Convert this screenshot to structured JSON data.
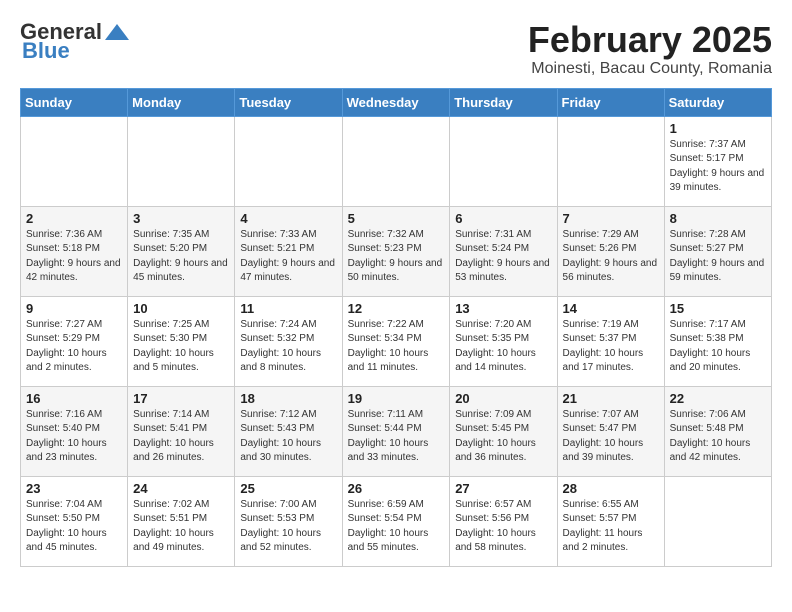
{
  "logo": {
    "general": "General",
    "blue": "Blue"
  },
  "title": "February 2025",
  "subtitle": "Moinesti, Bacau County, Romania",
  "days_of_week": [
    "Sunday",
    "Monday",
    "Tuesday",
    "Wednesday",
    "Thursday",
    "Friday",
    "Saturday"
  ],
  "weeks": [
    [
      {
        "day": "",
        "info": ""
      },
      {
        "day": "",
        "info": ""
      },
      {
        "day": "",
        "info": ""
      },
      {
        "day": "",
        "info": ""
      },
      {
        "day": "",
        "info": ""
      },
      {
        "day": "",
        "info": ""
      },
      {
        "day": "1",
        "info": "Sunrise: 7:37 AM\nSunset: 5:17 PM\nDaylight: 9 hours and 39 minutes."
      }
    ],
    [
      {
        "day": "2",
        "info": "Sunrise: 7:36 AM\nSunset: 5:18 PM\nDaylight: 9 hours and 42 minutes."
      },
      {
        "day": "3",
        "info": "Sunrise: 7:35 AM\nSunset: 5:20 PM\nDaylight: 9 hours and 45 minutes."
      },
      {
        "day": "4",
        "info": "Sunrise: 7:33 AM\nSunset: 5:21 PM\nDaylight: 9 hours and 47 minutes."
      },
      {
        "day": "5",
        "info": "Sunrise: 7:32 AM\nSunset: 5:23 PM\nDaylight: 9 hours and 50 minutes."
      },
      {
        "day": "6",
        "info": "Sunrise: 7:31 AM\nSunset: 5:24 PM\nDaylight: 9 hours and 53 minutes."
      },
      {
        "day": "7",
        "info": "Sunrise: 7:29 AM\nSunset: 5:26 PM\nDaylight: 9 hours and 56 minutes."
      },
      {
        "day": "8",
        "info": "Sunrise: 7:28 AM\nSunset: 5:27 PM\nDaylight: 9 hours and 59 minutes."
      }
    ],
    [
      {
        "day": "9",
        "info": "Sunrise: 7:27 AM\nSunset: 5:29 PM\nDaylight: 10 hours and 2 minutes."
      },
      {
        "day": "10",
        "info": "Sunrise: 7:25 AM\nSunset: 5:30 PM\nDaylight: 10 hours and 5 minutes."
      },
      {
        "day": "11",
        "info": "Sunrise: 7:24 AM\nSunset: 5:32 PM\nDaylight: 10 hours and 8 minutes."
      },
      {
        "day": "12",
        "info": "Sunrise: 7:22 AM\nSunset: 5:34 PM\nDaylight: 10 hours and 11 minutes."
      },
      {
        "day": "13",
        "info": "Sunrise: 7:20 AM\nSunset: 5:35 PM\nDaylight: 10 hours and 14 minutes."
      },
      {
        "day": "14",
        "info": "Sunrise: 7:19 AM\nSunset: 5:37 PM\nDaylight: 10 hours and 17 minutes."
      },
      {
        "day": "15",
        "info": "Sunrise: 7:17 AM\nSunset: 5:38 PM\nDaylight: 10 hours and 20 minutes."
      }
    ],
    [
      {
        "day": "16",
        "info": "Sunrise: 7:16 AM\nSunset: 5:40 PM\nDaylight: 10 hours and 23 minutes."
      },
      {
        "day": "17",
        "info": "Sunrise: 7:14 AM\nSunset: 5:41 PM\nDaylight: 10 hours and 26 minutes."
      },
      {
        "day": "18",
        "info": "Sunrise: 7:12 AM\nSunset: 5:43 PM\nDaylight: 10 hours and 30 minutes."
      },
      {
        "day": "19",
        "info": "Sunrise: 7:11 AM\nSunset: 5:44 PM\nDaylight: 10 hours and 33 minutes."
      },
      {
        "day": "20",
        "info": "Sunrise: 7:09 AM\nSunset: 5:45 PM\nDaylight: 10 hours and 36 minutes."
      },
      {
        "day": "21",
        "info": "Sunrise: 7:07 AM\nSunset: 5:47 PM\nDaylight: 10 hours and 39 minutes."
      },
      {
        "day": "22",
        "info": "Sunrise: 7:06 AM\nSunset: 5:48 PM\nDaylight: 10 hours and 42 minutes."
      }
    ],
    [
      {
        "day": "23",
        "info": "Sunrise: 7:04 AM\nSunset: 5:50 PM\nDaylight: 10 hours and 45 minutes."
      },
      {
        "day": "24",
        "info": "Sunrise: 7:02 AM\nSunset: 5:51 PM\nDaylight: 10 hours and 49 minutes."
      },
      {
        "day": "25",
        "info": "Sunrise: 7:00 AM\nSunset: 5:53 PM\nDaylight: 10 hours and 52 minutes."
      },
      {
        "day": "26",
        "info": "Sunrise: 6:59 AM\nSunset: 5:54 PM\nDaylight: 10 hours and 55 minutes."
      },
      {
        "day": "27",
        "info": "Sunrise: 6:57 AM\nSunset: 5:56 PM\nDaylight: 10 hours and 58 minutes."
      },
      {
        "day": "28",
        "info": "Sunrise: 6:55 AM\nSunset: 5:57 PM\nDaylight: 11 hours and 2 minutes."
      },
      {
        "day": "",
        "info": ""
      }
    ]
  ]
}
